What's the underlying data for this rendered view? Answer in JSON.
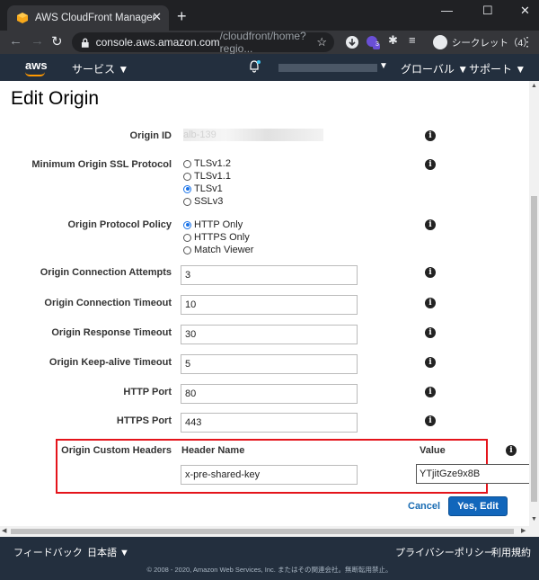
{
  "browser": {
    "tab_title": "AWS CloudFront Management C",
    "new_tab": "+",
    "tab_close": "✕",
    "window_controls": [
      "—",
      "☐",
      "✕"
    ],
    "url_host": "console.aws.amazon.com",
    "url_path": "/cloudfront/home?regio...",
    "incognito_label": "シークレット（4）",
    "extension_badge": "3"
  },
  "aws_nav": {
    "logo": "aws",
    "services": "サービス ▼",
    "region": "グローバル ▼",
    "support": "サポート ▼",
    "account_caret": "▼"
  },
  "page": {
    "title": "Edit Origin"
  },
  "form": {
    "origin_id_label": "Origin ID",
    "origin_id_value": "alb-139",
    "min_ssl_label": "Minimum Origin SSL Protocol",
    "ssl_options": [
      "TLSv1.2",
      "TLSv1.1",
      "TLSv1",
      "SSLv3"
    ],
    "ssl_selected": "TLSv1",
    "protocol_policy_label": "Origin Protocol Policy",
    "protocol_options": [
      "HTTP Only",
      "HTTPS Only",
      "Match Viewer"
    ],
    "protocol_selected": "HTTP Only",
    "connection_attempts_label": "Origin Connection Attempts",
    "connection_attempts": "3",
    "connection_timeout_label": "Origin Connection Timeout",
    "connection_timeout": "10",
    "response_timeout_label": "Origin Response Timeout",
    "response_timeout": "30",
    "keepalive_timeout_label": "Origin Keep-alive Timeout",
    "keepalive_timeout": "5",
    "http_port_label": "HTTP Port",
    "http_port": "80",
    "https_port_label": "HTTPS Port",
    "https_port": "443",
    "custom_headers_label": "Origin Custom Headers",
    "header_name_col": "Header Name",
    "value_col": "Value",
    "header_name_value": "x-pre-shared-key",
    "header_value_value": "YTjitGze9x8B",
    "info_glyph": "i",
    "highlight_color": "#e4141b"
  },
  "actions": {
    "cancel": "Cancel",
    "submit": "Yes, Edit"
  },
  "footer": {
    "feedback": "フィードバック",
    "language": "日本語 ▼",
    "privacy": "プライバシーポリシー",
    "terms": "利用規約",
    "copyright": "© 2008 - 2020, Amazon Web Services, Inc. またはその関連会社。無断転用禁止。"
  }
}
